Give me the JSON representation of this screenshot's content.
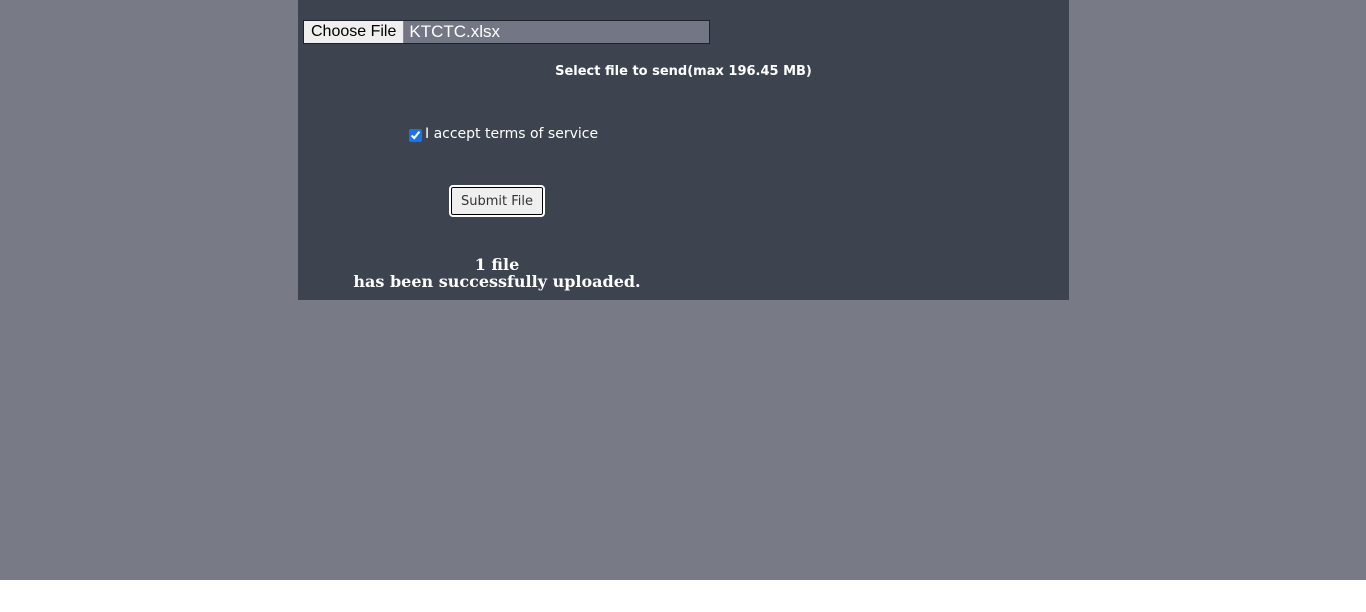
{
  "upload_form": {
    "choose_file_label": "Choose File",
    "selected_file_name": "KTCTC.xlsx",
    "select_hint": "Select file to send(max 196.45 MB)",
    "terms_label": "I accept terms of service",
    "terms_checked": true,
    "submit_label": "Submit File"
  },
  "result": {
    "count_line": "1 file",
    "status_line": "has been successfully uploaded."
  },
  "colors": {
    "page_background": "#787b86",
    "panel_background": "#3e444f",
    "checkbox_accent": "#1a73e8"
  }
}
